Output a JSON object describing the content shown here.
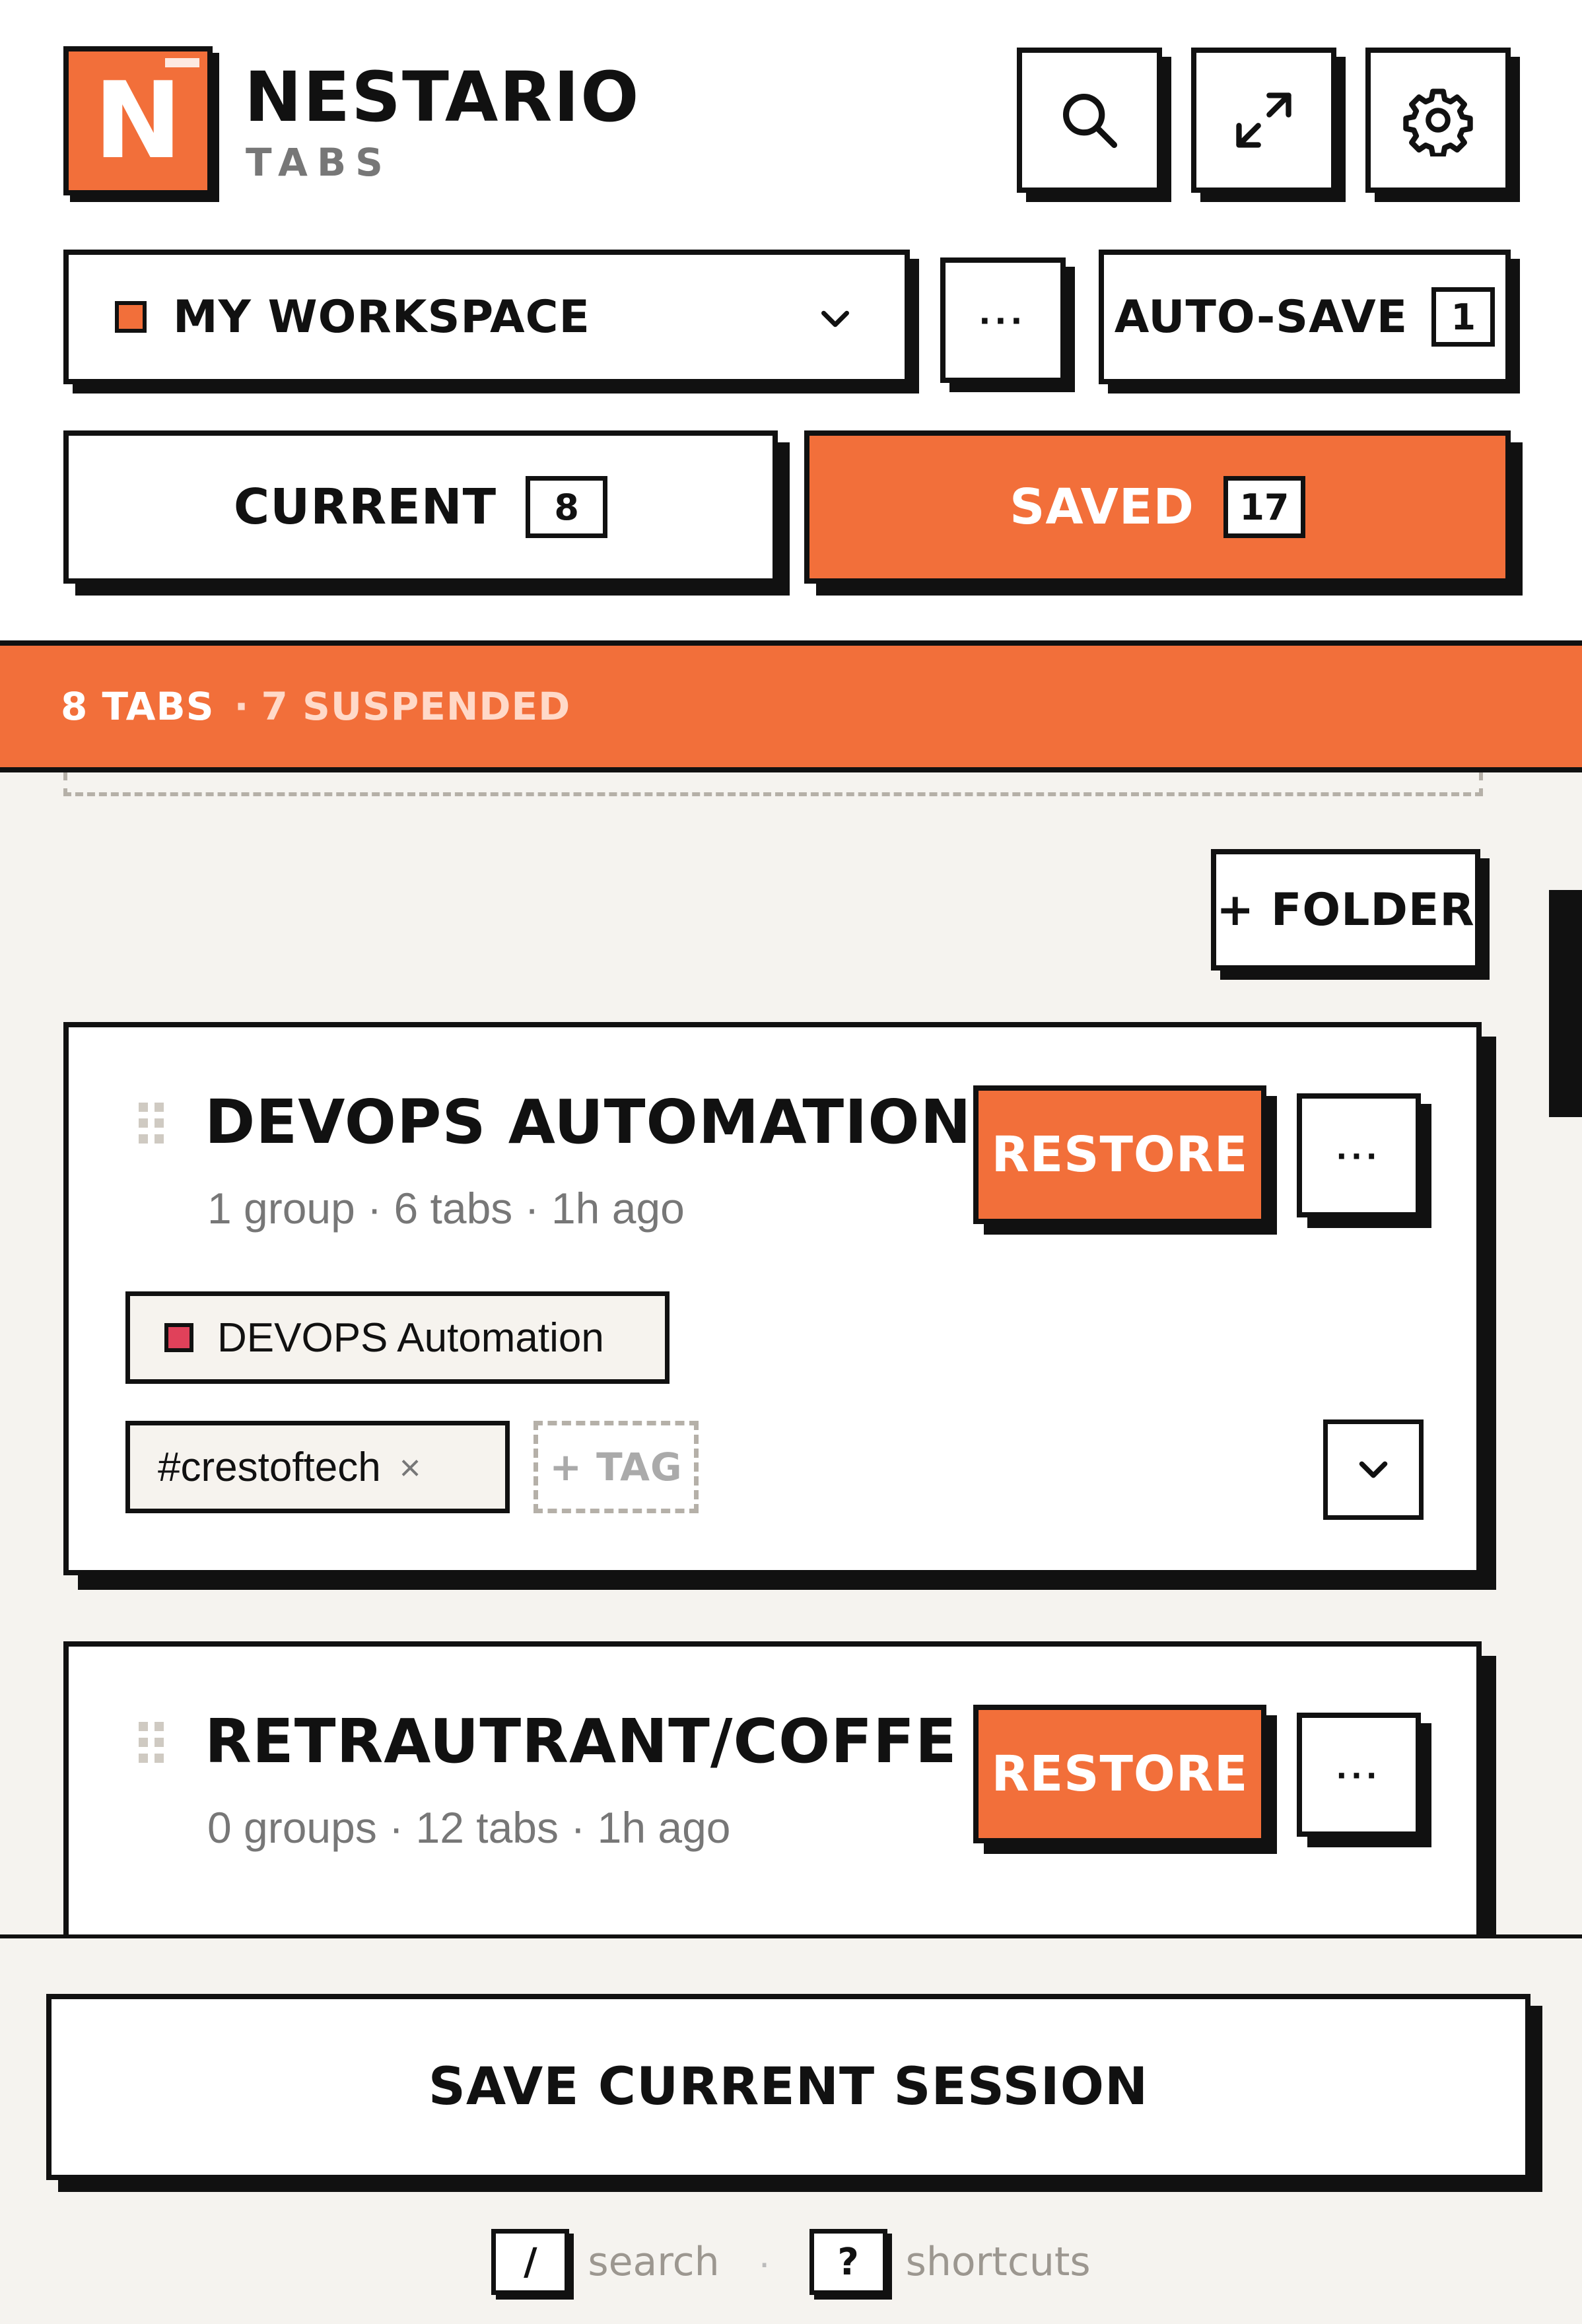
{
  "header": {
    "logo_letter": "N",
    "brand_name": "NESTARIO",
    "brand_sub": "TABS",
    "icons": [
      "search-icon",
      "expand-icon",
      "gear-icon"
    ]
  },
  "workspace": {
    "selected": "MY WORKSPACE",
    "more_label": "···",
    "autosave_label": "AUTO-SAVE",
    "autosave_count": "1"
  },
  "tabs": [
    {
      "label": "CURRENT",
      "count": "8"
    },
    {
      "label": "SAVED",
      "count": "17"
    }
  ],
  "status": {
    "tabs": "8 TABS",
    "separator": "·",
    "suspended": "7 SUSPENDED"
  },
  "folder_button": "+ FOLDER",
  "sessions": [
    {
      "title": "DEVOPS AUTOMATION",
      "meta": "1 group · 6 tabs · 1h ago",
      "restore": "RESTORE",
      "more": "···",
      "group": "DEVOPS Automation",
      "tag": "#crestoftech",
      "tag_remove": "×",
      "add_tag": "+ TAG"
    },
    {
      "title": "RETRAUTRANT/COFFE DIGI...",
      "meta": "0 groups · 12 tabs · 1h ago",
      "restore": "RESTORE",
      "more": "···"
    }
  ],
  "footer": {
    "save_button": "SAVE CURRENT SESSION",
    "hint1_key": "/",
    "hint1_label": "search",
    "hint_sep": "·",
    "hint2_key": "?",
    "hint2_label": "shortcuts"
  },
  "colors": {
    "accent": "#f26f3a",
    "ink": "#111111",
    "background": "#f5f3ef",
    "group_swatch": "#e0415a"
  }
}
